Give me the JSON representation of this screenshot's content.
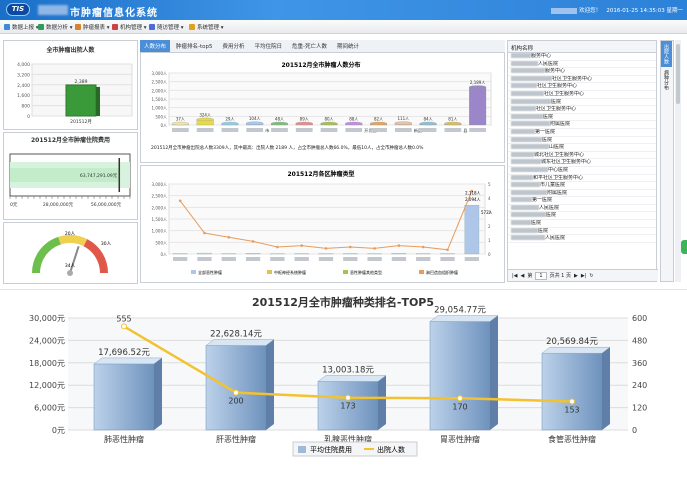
{
  "header": {
    "logo": "TIS",
    "title": "市肿瘤信息化系统",
    "greeting": "欢迎您！",
    "datetime": "2016-01-25 14:35:03 星期一"
  },
  "menu": [
    {
      "label": "数据上报",
      "color": "#3c8ad8"
    },
    {
      "label": "数据分析",
      "color": "#2d9c59"
    },
    {
      "label": "肿瘤报表",
      "color": "#d9822b"
    },
    {
      "label": "机构管理",
      "color": "#c94545"
    },
    {
      "label": "随访管理",
      "color": "#4c6ad8"
    },
    {
      "label": "系统管理",
      "color": "#e0a020"
    }
  ],
  "left_bar": {
    "title": "全市肿瘤出院人数",
    "yticks": [
      "4,000",
      "3,200",
      "2,400",
      "1,600",
      "800",
      "0"
    ],
    "value_label": "2,389",
    "category": "201512月",
    "value": 2389,
    "ymax": 4000
  },
  "left_bullet": {
    "title": "201512月全市肿瘤住院费用",
    "value_label": "63,747,291.09元",
    "ticks": [
      "0元",
      "28,000,000元",
      "56,000,000元"
    ],
    "value": 63747291.09,
    "max": 70000000
  },
  "gauge": {
    "ticks": [
      "20人",
      "30人",
      "34人"
    ],
    "value": 34
  },
  "tabs": [
    "人数分布",
    "肿瘤排名-top5",
    "费用分析",
    "平均住院日",
    "危重-死亡人数",
    "期间统计"
  ],
  "dist_chart": {
    "title": "201512月全市肿瘤人数分布",
    "yticks": [
      "3,000人",
      "2,500人",
      "2,000人",
      "1,500人",
      "1,000人",
      "500人",
      "0人"
    ],
    "bars": [
      {
        "label": "37人",
        "v": 37,
        "c": "#f2e6a8"
      },
      {
        "label": "324人",
        "v": 324,
        "c": "#e6d94c"
      },
      {
        "label": "29人",
        "v": 29,
        "c": "#8fd0e8"
      },
      {
        "label": "104人",
        "v": 104,
        "c": "#a6c7ee"
      },
      {
        "label": "48人",
        "v": 48,
        "c": "#79c17a"
      },
      {
        "label": "89人",
        "v": 89,
        "c": "#e88c8c"
      },
      {
        "label": "80人",
        "v": 80,
        "c": "#a8c050"
      },
      {
        "label": "88人",
        "v": 88,
        "c": "#c58be0"
      },
      {
        "label": "82人",
        "v": 82,
        "c": "#e8a45c"
      },
      {
        "label": "111人",
        "v": 111,
        "c": "#e7c2a8"
      },
      {
        "label": "84人",
        "v": 84,
        "c": "#8ec0d8"
      },
      {
        "label": "81人",
        "v": 81,
        "c": "#d8c060"
      },
      {
        "label": "2,189人",
        "v": 2189,
        "c": "#9a86c8"
      }
    ],
    "xlabels": [
      "",
      "",
      "",
      "市",
      "",
      "",
      "",
      "开发区",
      "",
      "新区",
      "",
      "县",
      ""
    ],
    "ymax": 3000
  },
  "dist_note": "201512月全市肿瘤出院总人数3309人，其中最高：出院人数 2189 人，占全市肿瘤总人数66.0%，最低10人，占全市肿瘤总人数0.0%",
  "type_chart": {
    "title": "201512月各区肿瘤类型",
    "yticks": [
      "3,000人",
      "2,500人",
      "2,000人",
      "1,500人",
      "1,000人",
      "500人",
      "0人"
    ],
    "y2ticks": [
      "5",
      "4",
      "3",
      "2",
      "1",
      "0"
    ],
    "annot": [
      "2,094人",
      "572人",
      "2,118人"
    ],
    "legend": [
      "全部恶性肿瘤",
      "中枢神经系统肿瘤",
      "恶性肿瘤其他类型",
      "淋巴造血组织肿瘤"
    ]
  },
  "org_list": {
    "header": "机构名称",
    "rows": [
      "服务中心",
      "人民医院",
      "服务中心",
      "社区卫生服务中心",
      "社区卫生服务中心",
      "社区卫生服务中心",
      "医院",
      "社区卫生服务中心",
      "医院",
      "附属医院",
      "第一医院",
      "医院",
      "山医院",
      "城北社区卫生服务中心",
      "城东社区卫生服务中心",
      "中心医院",
      "和平社区卫生服务中心",
      "市儿童医院",
      "附属医院",
      "第一医院",
      "人民医院",
      "医院",
      "医院",
      "医院",
      "人民医院"
    ],
    "pager": {
      "page": "1",
      "total": "页共 1 页"
    }
  },
  "side_tabs": [
    "出院人数",
    "病种分布"
  ],
  "bottom_chart": {
    "title": "201512月全市肿瘤种类排名-TOP5",
    "yticks": [
      "30,000元",
      "24,000元",
      "18,000元",
      "12,000元",
      "6,000元",
      "0元"
    ],
    "y2ticks": [
      "600",
      "480",
      "360",
      "240",
      "120",
      "0"
    ],
    "categories": [
      "肺恶性肿瘤",
      "肝恶性肿瘤",
      "乳腺恶性肿瘤",
      "胃恶性肿瘤",
      "食管恶性肿瘤"
    ],
    "cost": [
      17696.52,
      22628.14,
      13003.18,
      29054.77,
      20569.84
    ],
    "cost_labels": [
      "17,696.52元",
      "22,628.14元",
      "13,003.18元",
      "29,054.77元",
      "20,569.84元"
    ],
    "count": [
      555,
      200,
      173,
      170,
      153
    ],
    "ymax": 30000,
    "y2max": 600,
    "legend": [
      "平均住院费用",
      "出院人数"
    ]
  }
}
